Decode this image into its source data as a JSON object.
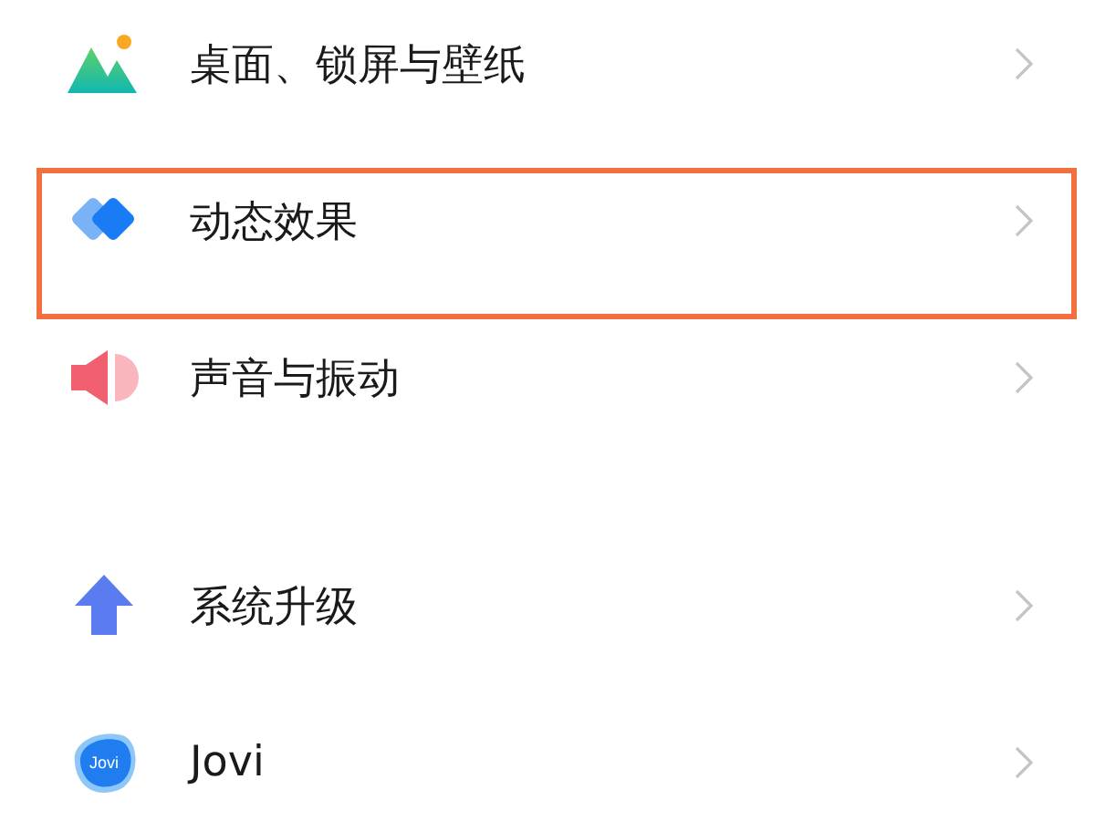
{
  "groups": [
    {
      "items": [
        {
          "label": "桌面、锁屏与壁纸",
          "kind": "mountain",
          "highlighted": false
        },
        {
          "label": "动态效果",
          "kind": "diamonds",
          "highlighted": true
        },
        {
          "label": "声音与振动",
          "kind": "speaker",
          "highlighted": false
        }
      ]
    },
    {
      "items": [
        {
          "label": "系统升级",
          "kind": "arrow",
          "highlighted": false
        },
        {
          "label": "Jovi",
          "kind": "blob",
          "icon_text": "Jovi",
          "highlighted": false
        }
      ]
    }
  ]
}
